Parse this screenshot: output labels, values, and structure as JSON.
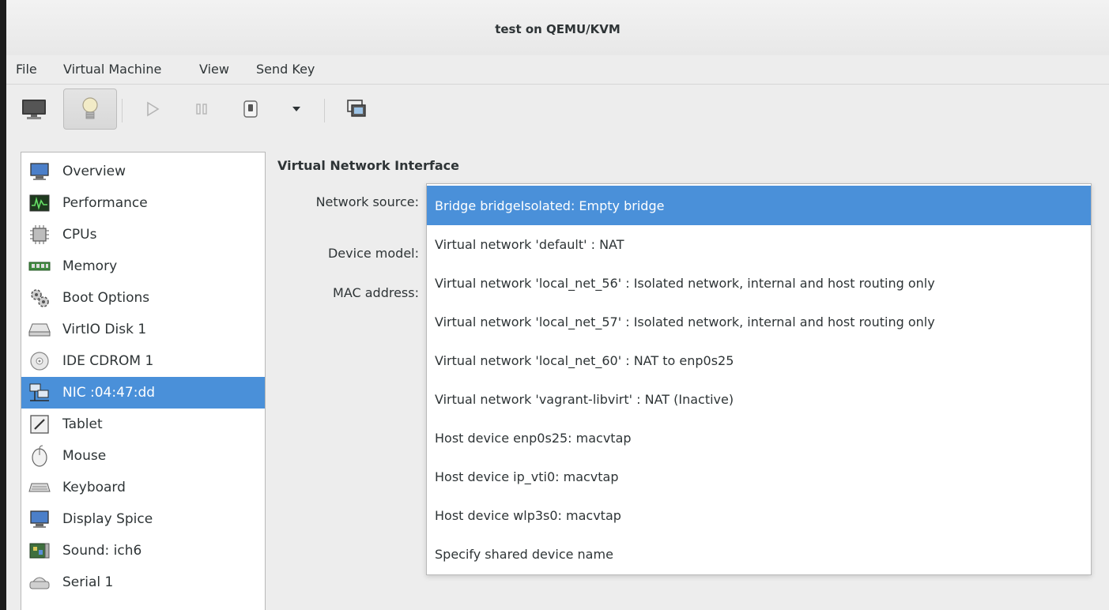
{
  "window": {
    "title": "test on QEMU/KVM"
  },
  "menu": [
    "File",
    "Virtual Machine",
    "View",
    "Send Key"
  ],
  "toolbar": {
    "buttons": [
      {
        "icon": "monitor-icon"
      },
      {
        "icon": "lightbulb-icon",
        "pressed": true
      },
      {
        "icon": "play-icon"
      },
      {
        "icon": "pause-icon"
      },
      {
        "icon": "power-icon"
      },
      {
        "icon": "dropdown-arrow-icon"
      },
      {
        "icon": "screenshot-icon"
      }
    ]
  },
  "sidebar": {
    "items": [
      {
        "label": "Overview",
        "icon": "monitor-icon"
      },
      {
        "label": "Performance",
        "icon": "performance-graph-icon"
      },
      {
        "label": "CPUs",
        "icon": "cpu-chip-icon"
      },
      {
        "label": "Memory",
        "icon": "memory-icon"
      },
      {
        "label": "Boot Options",
        "icon": "gears-icon"
      },
      {
        "label": "VirtIO Disk 1",
        "icon": "hard-disk-icon"
      },
      {
        "label": "IDE CDROM 1",
        "icon": "cdrom-icon"
      },
      {
        "label": "NIC :04:47:dd",
        "icon": "network-icon",
        "selected": true
      },
      {
        "label": "Tablet",
        "icon": "tablet-icon"
      },
      {
        "label": "Mouse",
        "icon": "mouse-icon"
      },
      {
        "label": "Keyboard",
        "icon": "keyboard-icon"
      },
      {
        "label": "Display Spice",
        "icon": "display-icon"
      },
      {
        "label": "Sound: ich6",
        "icon": "sound-card-icon"
      },
      {
        "label": "Serial 1",
        "icon": "serial-icon"
      }
    ]
  },
  "content": {
    "title": "Virtual Network Interface",
    "network_source_label": "Network source:",
    "device_model_label": "Device model:",
    "mac_address_label": "MAC address:"
  },
  "network_source_options": [
    {
      "label": "Bridge bridgeIsolated: Empty bridge",
      "selected": true
    },
    {
      "label": "Virtual network 'default' : NAT"
    },
    {
      "label": "Virtual network 'local_net_56' : Isolated network, internal and host routing only"
    },
    {
      "label": "Virtual network 'local_net_57' : Isolated network, internal and host routing only"
    },
    {
      "label": "Virtual network 'local_net_60' : NAT to enp0s25"
    },
    {
      "label": "Virtual network 'vagrant-libvirt' : NAT (Inactive)"
    },
    {
      "label": "Host device enp0s25: macvtap"
    },
    {
      "label": "Host device ip_vti0: macvtap"
    },
    {
      "label": "Host device wlp3s0: macvtap"
    },
    {
      "label": "Specify shared device name"
    }
  ],
  "colors": {
    "selection": "#4a90d9",
    "window_bg": "#ededed"
  }
}
